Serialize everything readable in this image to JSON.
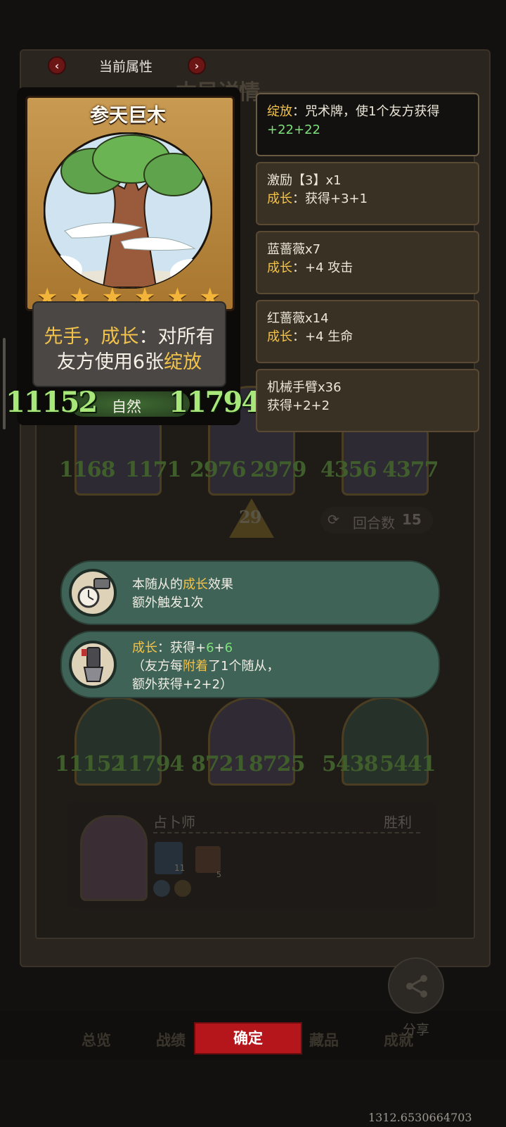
{
  "header": {
    "title": "当前属性",
    "prev_icon": "chevron-left-icon",
    "next_icon": "chevron-right-icon"
  },
  "card": {
    "name": "参天巨木",
    "stars": 6,
    "desc_line1_a": "先手，",
    "desc_line1_b": "成长",
    "desc_line1_c": "：对所有",
    "desc_line2_a": "友方使用6张",
    "desc_line2_b": "绽放",
    "attack": "11152",
    "health": "11794",
    "tribe": "自然"
  },
  "effects": [
    {
      "l1_kw": "绽放",
      "l1_rest": "：咒术牌，使1个友方获得",
      "l2": "+22+22"
    },
    {
      "l1": "激励【3】x1",
      "l2_kw": "成长",
      "l2_rest": "：获得+3+1"
    },
    {
      "l1": "蓝蔷薇x7",
      "l2_kw": "成长",
      "l2_rest": "：+4 攻击"
    },
    {
      "l1": "红蔷薇x14",
      "l2_kw": "成长",
      "l2_rest": "：+4 生命"
    },
    {
      "l1": "机械手臂x36",
      "l2": "获得+2+2"
    }
  ],
  "tooltips": [
    {
      "t1_a": "本随从的",
      "t1_kw": "成长",
      "t1_b": "效果",
      "t2": "额外触发1次"
    },
    {
      "t1_kw": "成长",
      "t1_a": "：获得+",
      "t1_n1": "6",
      "t1_b": "+",
      "t1_n2": "6",
      "t2_a": "（友方每",
      "t2_kw": "附着",
      "t2_b": "了1个随从，",
      "t3": "额外获得+2+2）"
    }
  ],
  "background": {
    "title": "本局详情",
    "row1": [
      "1168",
      "1171",
      "2976",
      "2979",
      "4356",
      "4377"
    ],
    "arrow_count": "29",
    "round_label": "回合数",
    "round_value": "15",
    "row2": [
      "11152",
      "11794",
      "8721",
      "8725",
      "5438",
      "5441"
    ],
    "player_name": "占卜师",
    "result": "胜利",
    "badge_count_1": "11",
    "badge_count_2": "5"
  },
  "bottom": {
    "confirm": "确定",
    "tabs": [
      "总览",
      "战绩",
      "藏品",
      "成就"
    ],
    "share": "分享"
  },
  "coord_readout": "1312.6530664703"
}
